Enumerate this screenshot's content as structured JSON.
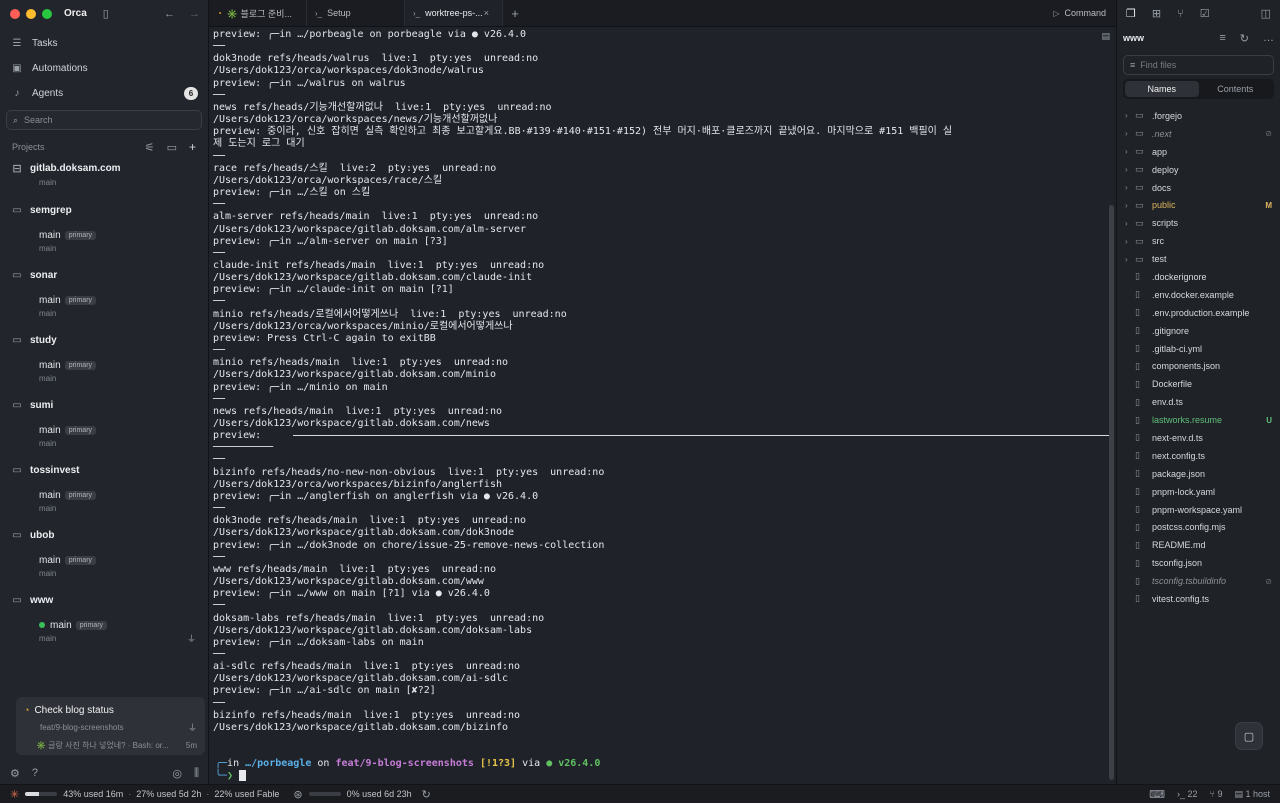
{
  "app": {
    "name": "Orca"
  },
  "sidebar": {
    "nav": [
      {
        "label": "Tasks",
        "icon": "list-icon"
      },
      {
        "label": "Automations",
        "icon": "calendar-icon"
      },
      {
        "label": "Agents",
        "icon": "bell-icon",
        "badge": "6"
      }
    ],
    "search_placeholder": "Search",
    "projects_label": "Projects",
    "repo": {
      "title": "gitlab.doksam.com",
      "sub": "main"
    },
    "groups": [
      {
        "name": "semgrep",
        "branch": "main",
        "pill": "primary",
        "sub": "main"
      },
      {
        "name": "sonar",
        "branch": "main",
        "pill": "primary",
        "sub": "main"
      },
      {
        "name": "study",
        "branch": "main",
        "pill": "primary",
        "sub": "main"
      },
      {
        "name": "sumi",
        "branch": "main",
        "pill": "primary",
        "sub": "main"
      },
      {
        "name": "tossinvest",
        "branch": "main",
        "pill": "primary",
        "sub": "main"
      },
      {
        "name": "ubob",
        "branch": "main",
        "pill": "primary",
        "sub": "main"
      },
      {
        "name": "www",
        "branch": "main",
        "pill": "primary",
        "sub": "main"
      }
    ],
    "card": {
      "title": "Check blog status",
      "branch": "feat/9-blog-screenshots",
      "foot": "✳️ 글랑 사진 하나 넣었네? · Bash: or...",
      "time": "5m"
    }
  },
  "tabs": [
    {
      "label": "✳️ 블로그 준비..."
    },
    {
      "label": "Setup"
    },
    {
      "label": "worktree-ps-..."
    }
  ],
  "command_label": "Command",
  "terminal": {
    "lines": [
      "preview: ╭─in …/porbeagle on porbeagle via ● v26.4.0",
      "──",
      "dok3node refs/heads/walrus  live:1  pty:yes  unread:no",
      "/Users/dok123/orca/workspaces/dok3node/walrus",
      "preview: ╭─in …/walrus on walrus",
      "──",
      "news refs/heads/기능개선할꺼없나  live:1  pty:yes  unread:no",
      "/Users/dok123/orca/workspaces/news/기능개선할꺼없나",
      "preview: 중이라, 신호 잡히면 실측 확인하고 최종 보고할게요.BB·#139·#140·#151·#152) 전부 머지·배포·클로즈까지 끝냈어요. 마지막으로 #151 백필이 실",
      "제 도는지 로그 대기",
      "──",
      "race refs/heads/스킬  live:2  pty:yes  unread:no",
      "/Users/dok123/orca/workspaces/race/스킬",
      "preview: ╭─in …/스킬 on 스킬",
      "──",
      "alm-server refs/heads/main  live:1  pty:yes  unread:no",
      "/Users/dok123/workspace/gitlab.doksam.com/alm-server",
      "preview: ╭─in …/alm-server on main [?3]",
      "──",
      "claude-init refs/heads/main  live:1  pty:yes  unread:no",
      "/Users/dok123/workspace/gitlab.doksam.com/claude-init",
      "preview: ╭─in …/claude-init on main [?1]",
      "──",
      "minio refs/heads/로컬에서어떻게쓰나  live:1  pty:yes  unread:no",
      "/Users/dok123/orca/workspaces/minio/로컬에서어떻게쓰나",
      "preview: Press Ctrl-C again to exitBB",
      "──",
      "minio refs/heads/main  live:1  pty:yes  unread:no",
      "/Users/dok123/workspace/gitlab.doksam.com/minio",
      "preview: ╭─in …/minio on main",
      "──",
      "news refs/heads/main  live:1  pty:yes  unread:no",
      "/Users/dok123/workspace/gitlab.doksam.com/news",
      "preview: ",
      "──────────",
      "──",
      "bizinfo refs/heads/no-new-non-obvious  live:1  pty:yes  unread:no",
      "/Users/dok123/orca/workspaces/bizinfo/anglerfish",
      "preview: ╭─in …/anglerfish on anglerfish via ● v26.4.0",
      "──",
      "dok3node refs/heads/main  live:1  pty:yes  unread:no",
      "/Users/dok123/workspace/gitlab.doksam.com/dok3node",
      "preview: ╭─in …/dok3node on chore/issue-25-remove-news-collection",
      "──",
      "www refs/heads/main  live:1  pty:yes  unread:no",
      "/Users/dok123/workspace/gitlab.doksam.com/www",
      "preview: ╭─in …/www on main [?1] via ● v26.4.0",
      "──",
      "doksam-labs refs/heads/main  live:1  pty:yes  unread:no",
      "/Users/dok123/workspace/gitlab.doksam.com/doksam-labs",
      "preview: ╭─in …/doksam-labs on main",
      "──",
      "ai-sdlc refs/heads/main  live:1  pty:yes  unread:no",
      "/Users/dok123/workspace/gitlab.doksam.com/ai-sdlc",
      "preview: ╭─in …/ai-sdlc on main [✘?2]",
      "──",
      "bizinfo refs/heads/main  live:1  pty:yes  unread:no",
      "/Users/dok123/workspace/gitlab.doksam.com/bizinfo"
    ],
    "prompt": {
      "pre": "in ",
      "path": "…/porbeagle",
      "on": " on ",
      "branch": "feat/9-blog-screenshots",
      "status": " [!1?3]",
      "via": " via ",
      "node": "● v26.4.0"
    }
  },
  "explorer": {
    "title": "www",
    "find_placeholder": "Find files",
    "seg": [
      "Names",
      "Contents"
    ],
    "folders": [
      {
        "name": ".forgejo",
        "state": ""
      },
      {
        "name": ".next",
        "state": "dim"
      },
      {
        "name": "app",
        "state": ""
      },
      {
        "name": "deploy",
        "state": ""
      },
      {
        "name": "docs",
        "state": ""
      },
      {
        "name": "public",
        "state": "mod",
        "status": "M"
      },
      {
        "name": "scripts",
        "state": ""
      },
      {
        "name": "src",
        "state": ""
      },
      {
        "name": "test",
        "state": ""
      }
    ],
    "files": [
      {
        "name": ".dockerignore",
        "state": ""
      },
      {
        "name": ".env.docker.example",
        "state": ""
      },
      {
        "name": ".env.production.example",
        "state": ""
      },
      {
        "name": ".gitignore",
        "state": ""
      },
      {
        "name": ".gitlab-ci.yml",
        "state": ""
      },
      {
        "name": "components.json",
        "state": ""
      },
      {
        "name": "Dockerfile",
        "state": ""
      },
      {
        "name": "env.d.ts",
        "state": ""
      },
      {
        "name": "lastworks.resume",
        "state": "new",
        "status": "U"
      },
      {
        "name": "next-env.d.ts",
        "state": ""
      },
      {
        "name": "next.config.ts",
        "state": ""
      },
      {
        "name": "package.json",
        "state": ""
      },
      {
        "name": "pnpm-lock.yaml",
        "state": ""
      },
      {
        "name": "pnpm-workspace.yaml",
        "state": ""
      },
      {
        "name": "postcss.config.mjs",
        "state": ""
      },
      {
        "name": "README.md",
        "state": ""
      },
      {
        "name": "tsconfig.json",
        "state": ""
      },
      {
        "name": "tsconfig.tsbuildinfo",
        "state": "dim"
      },
      {
        "name": "vitest.config.ts",
        "state": ""
      }
    ]
  },
  "status": {
    "usage1_pct": 0.43,
    "usage1": "43% used 16m",
    "usage2": "27% used 5d 2h",
    "usage3": "22% used Fable",
    "usage4_pct": 0.0,
    "usage4": "0% used 6d 23h",
    "terminals": "22",
    "branches": "9",
    "hosts": "1 host"
  }
}
